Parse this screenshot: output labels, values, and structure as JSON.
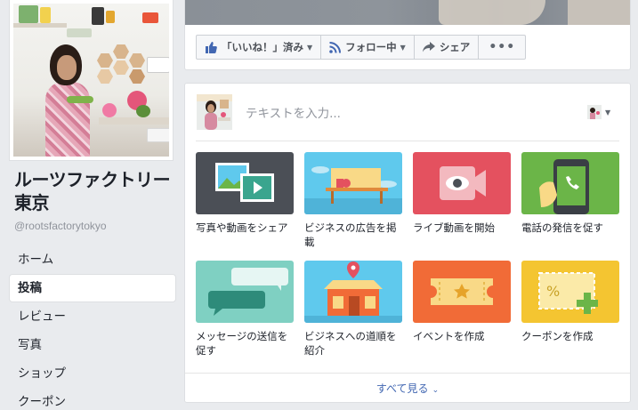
{
  "page": {
    "name": "ルーツファクトリー東京",
    "handle": "@rootsfactorytokyo"
  },
  "nav": {
    "items": [
      {
        "label": "ホーム",
        "active": false
      },
      {
        "label": "投稿",
        "active": true
      },
      {
        "label": "レビュー",
        "active": false
      },
      {
        "label": "写真",
        "active": false
      },
      {
        "label": "ショップ",
        "active": false
      },
      {
        "label": "クーポン",
        "active": false
      }
    ]
  },
  "actions": {
    "like": "「いいね！」済み",
    "follow": "フォロー中",
    "share": "シェア",
    "more": "•••"
  },
  "composer": {
    "placeholder": "テキストを入力..."
  },
  "tiles": [
    {
      "label": "写真や動画をシェア",
      "icon": "photo-video-icon",
      "color": "#4b4f56"
    },
    {
      "label": "ビジネスの広告を掲載",
      "icon": "advertise-icon",
      "color": "#5fc9ed"
    },
    {
      "label": "ライブ動画を開始",
      "icon": "live-video-icon",
      "color": "#e4515f"
    },
    {
      "label": "電話の発信を促す",
      "icon": "phone-call-icon",
      "color": "#6bb548"
    },
    {
      "label": "メッセージの送信を促す",
      "icon": "message-icon",
      "color": "#7fd0c2"
    },
    {
      "label": "ビジネスへの道順を紹介",
      "icon": "directions-icon",
      "color": "#5fc9ed"
    },
    {
      "label": "イベントを作成",
      "icon": "event-ticket-icon",
      "color": "#f16b37"
    },
    {
      "label": "クーポンを作成",
      "icon": "coupon-icon",
      "color": "#f4c531"
    }
  ],
  "see_all": "すべて見る",
  "colors": {
    "background": "#e9ebee",
    "link": "#4267b2",
    "like_blue": "#4267b2"
  }
}
